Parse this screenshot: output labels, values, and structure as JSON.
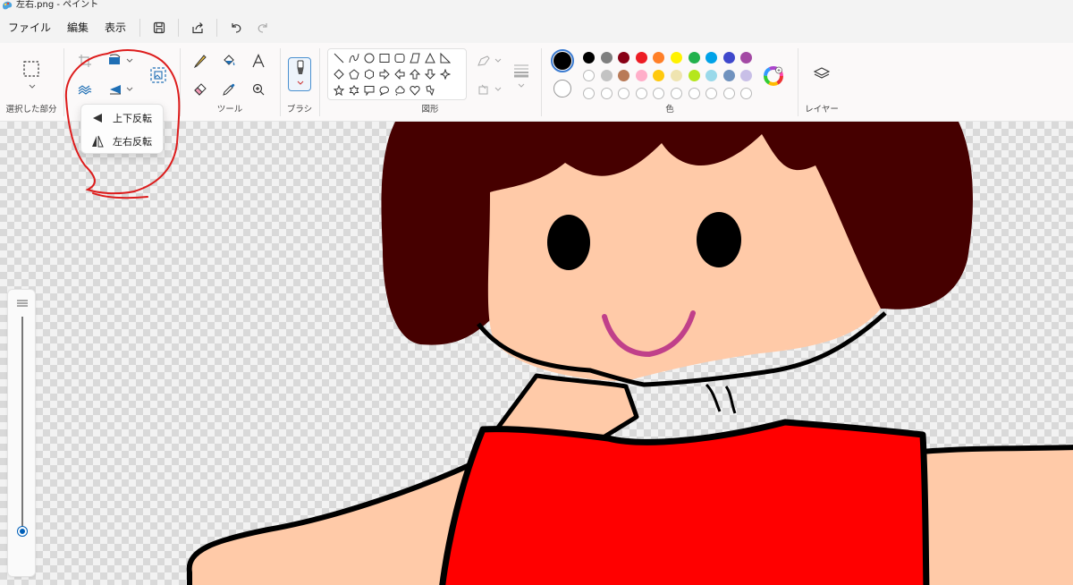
{
  "window": {
    "title": "左右.png - ペイント"
  },
  "menu": {
    "file": "ファイル",
    "edit": "編集",
    "view": "表示"
  },
  "quick_access": {
    "save_icon": "save-icon",
    "share_icon": "share-icon",
    "undo_icon": "undo-icon",
    "redo_icon": "redo-icon"
  },
  "ribbon": {
    "selection": {
      "label": "選択した部分"
    },
    "image": {
      "label": ""
    },
    "tools": {
      "label": "ツール"
    },
    "brush": {
      "label": "ブラシ"
    },
    "shapes": {
      "label": "図形"
    },
    "colors": {
      "label": "色",
      "primary": "#000000",
      "secondary": "#ffffff",
      "row1": [
        "#000000",
        "#7f7f7f",
        "#880015",
        "#ed1c24",
        "#ff7f27",
        "#fff200",
        "#22b14c",
        "#00a2e8",
        "#3f48cc",
        "#a349a4"
      ],
      "row2": [
        "#ffffff",
        "#c3c3c3",
        "#b97a57",
        "#ffaec9",
        "#ffc90e",
        "#efe4b0",
        "#b5e61d",
        "#99d9ea",
        "#7092be",
        "#c8bfe7"
      ]
    },
    "layers": {
      "label": "レイヤー"
    }
  },
  "rotate_menu": {
    "flip_vertical": "上下反転",
    "flip_horizontal": "左右反転"
  },
  "canvas": {
    "hair_color": "#460000",
    "skin_color": "#ffcaa8",
    "dress_color": "#ff0000",
    "mouth_color": "#c0408a",
    "outline_color": "#000000"
  },
  "zoom": {
    "level": 0.05
  },
  "annotation_color": "#dd1c1c"
}
